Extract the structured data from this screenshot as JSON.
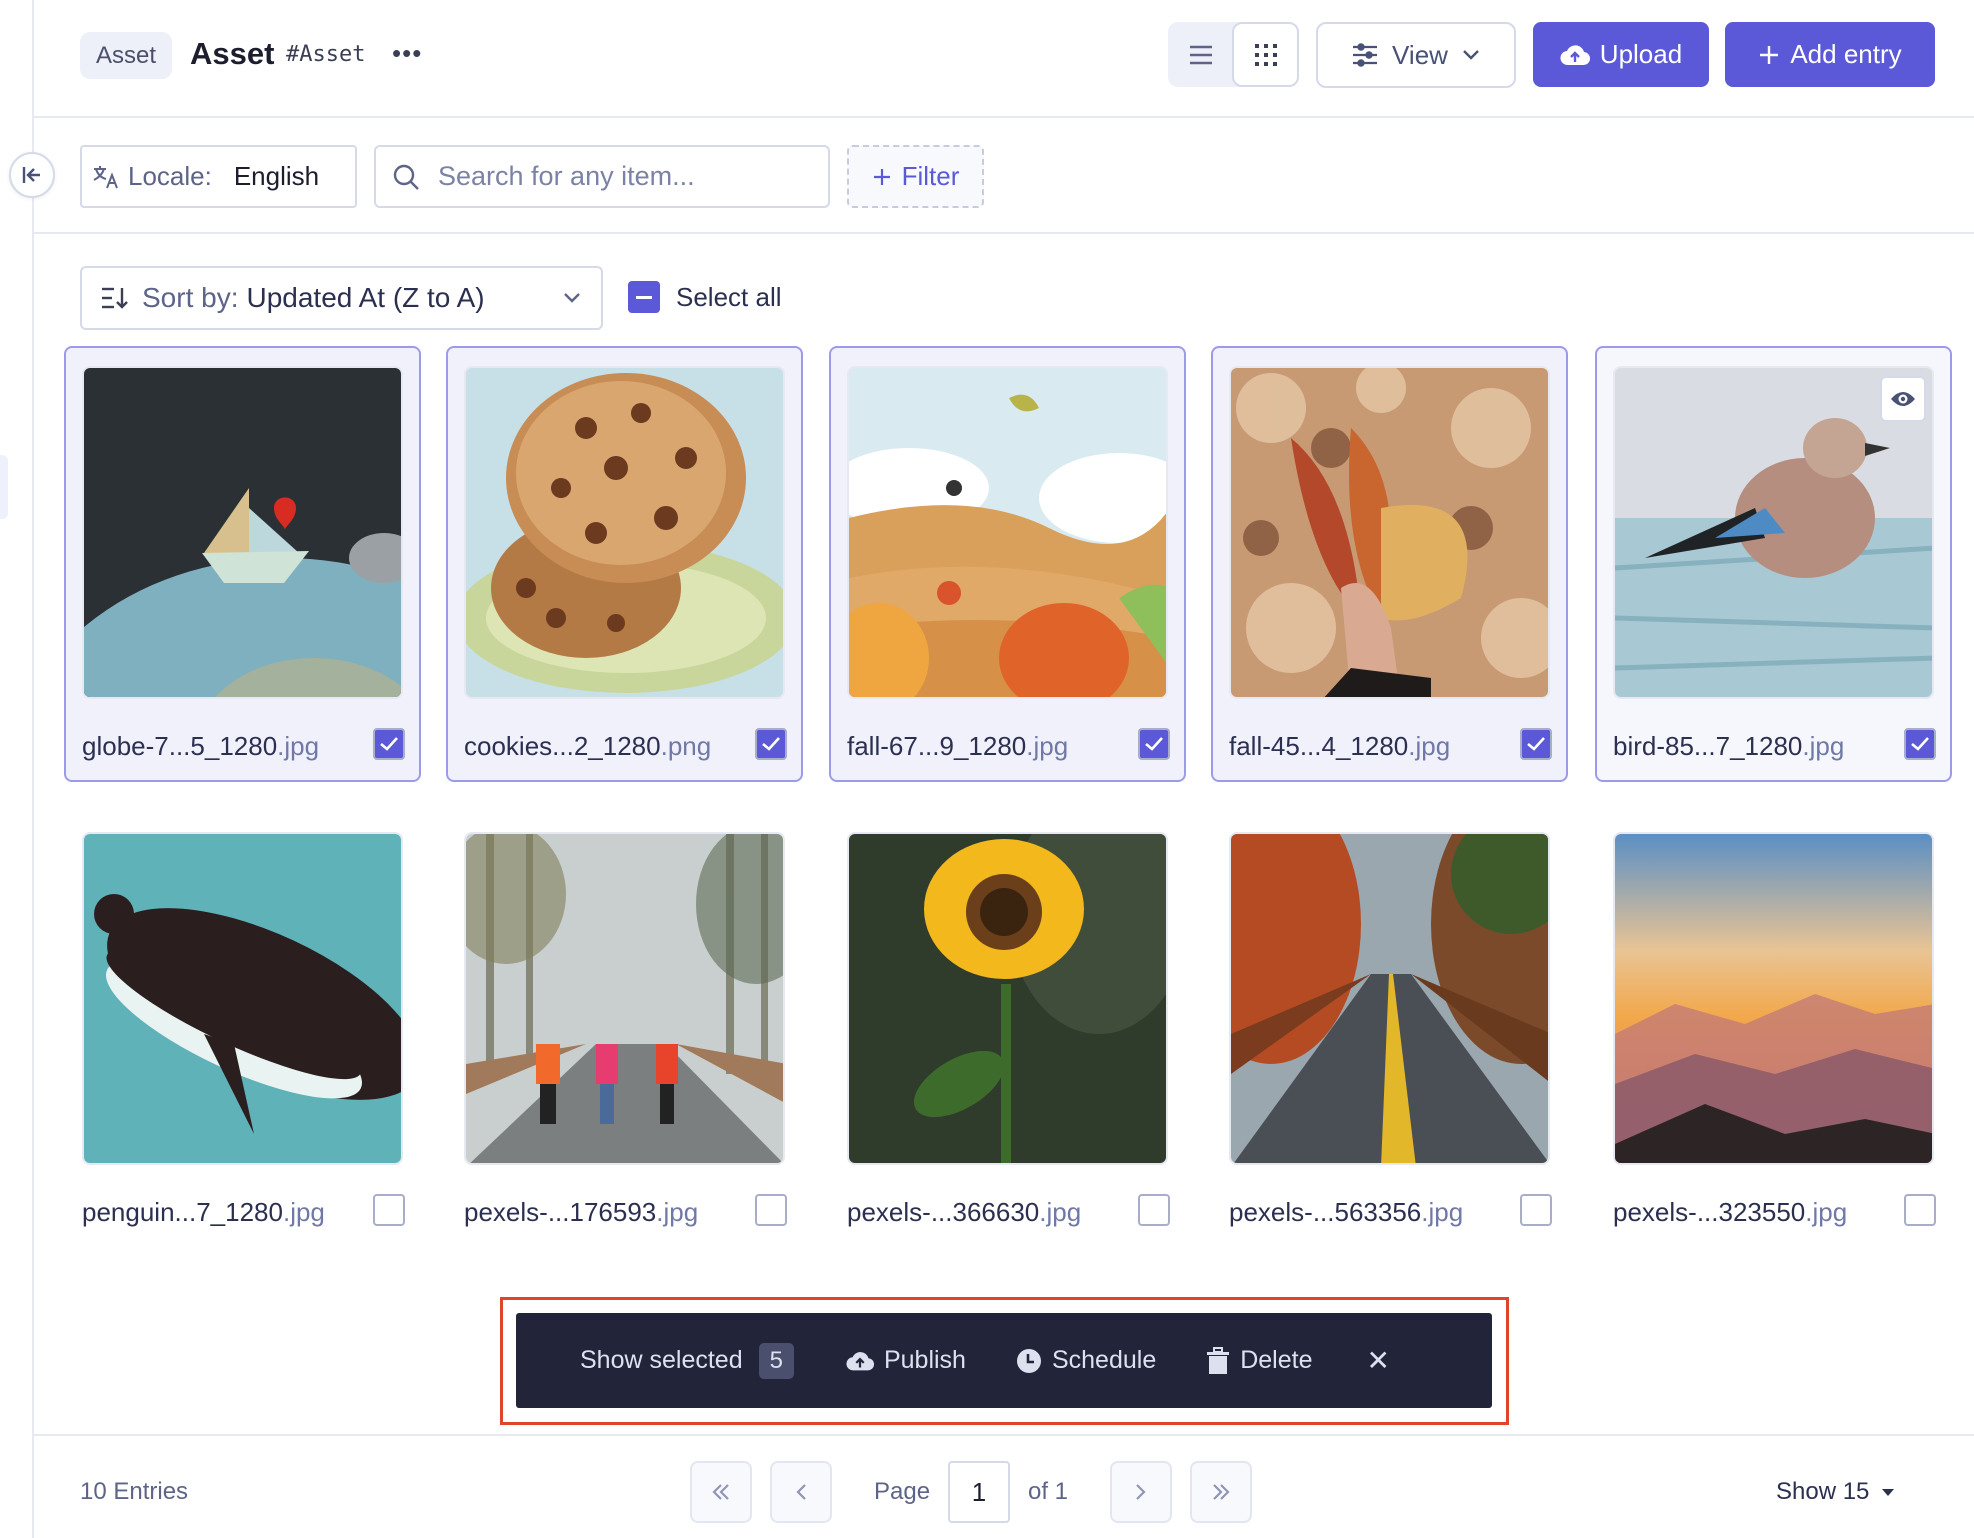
{
  "header": {
    "badge": "Asset",
    "title": "Asset",
    "key": "#Asset",
    "more": "•••",
    "view_label": "View",
    "upload_label": "Upload",
    "add_entry_label": "Add entry",
    "active_view": "grid"
  },
  "toolbar": {
    "locale_label": "Locale:",
    "locale_value": "English",
    "search_placeholder": "Search for any item...",
    "search_value": "",
    "filter_label": "Filter"
  },
  "sort": {
    "label": "Sort by:",
    "value": "Updated At (Z to A)",
    "select_all_label": "Select all",
    "select_all_state": "indeterminate"
  },
  "assets": [
    {
      "name": "globe-7...5_1280",
      "ext": ".jpg",
      "selected": true,
      "image": "globe-origami-boat"
    },
    {
      "name": "cookies...2_1280",
      "ext": ".png",
      "selected": true,
      "image": "cookies-illustration"
    },
    {
      "name": "fall-67...9_1280",
      "ext": ".jpg",
      "selected": true,
      "image": "autumn-pumpkins-illustration"
    },
    {
      "name": "fall-45...4_1280",
      "ext": ".jpg",
      "selected": true,
      "image": "hand-holding-leaves"
    },
    {
      "name": "bird-85...7_1280",
      "ext": ".jpg",
      "selected": true,
      "image": "jay-bird-on-branch",
      "hovered": true
    },
    {
      "name": "penguin...7_1280",
      "ext": ".jpg",
      "selected": false,
      "image": "penguin-swimming"
    },
    {
      "name": "pexels-...176593",
      "ext": ".jpg",
      "selected": false,
      "image": "friends-on-foggy-road"
    },
    {
      "name": "pexels-...366630",
      "ext": ".jpg",
      "selected": false,
      "image": "sunflower"
    },
    {
      "name": "pexels-...563356",
      "ext": ".jpg",
      "selected": false,
      "image": "autumn-road"
    },
    {
      "name": "pexels-...323550",
      "ext": ".jpg",
      "selected": false,
      "image": "mountain-sunset"
    }
  ],
  "action_bar": {
    "show_selected_label": "Show selected",
    "selected_count": "5",
    "publish_label": "Publish",
    "schedule_label": "Schedule",
    "delete_label": "Delete",
    "close_label": "✕"
  },
  "footer": {
    "entries": "10 Entries",
    "page_label": "Page",
    "page_value": "1",
    "of_label": "of 1",
    "show_label": "Show 15"
  },
  "colors": {
    "primary": "#5c59d8",
    "action_bar_bg": "#222539",
    "highlight": "#e0452b",
    "selected_card_bg": "#f1f1fc"
  }
}
